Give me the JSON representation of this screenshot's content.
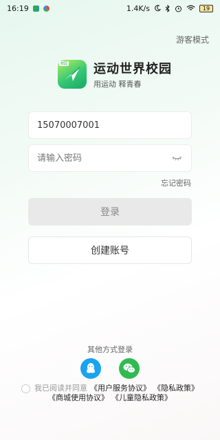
{
  "status_bar": {
    "time": "16:19",
    "network_speed": "1.4K/s",
    "battery": "19"
  },
  "header": {
    "guest_mode": "游客模式"
  },
  "brand": {
    "badge": "校园",
    "name": "运动世界校园",
    "slogan": "用运动 释青春",
    "accent_color": "#2ca66c"
  },
  "form": {
    "phone_value": "15070007001",
    "password_placeholder": "请输入密码",
    "forgot_password": "忘记密码"
  },
  "buttons": {
    "login": "登录",
    "create_account": "创建账号"
  },
  "other_login": {
    "label": "其他方式登录",
    "methods": [
      "qq-icon",
      "wechat-icon"
    ]
  },
  "agreement": {
    "prefix": "我已阅读并同意",
    "user_service": "《用户服务协议》",
    "privacy": "《隐私政策》",
    "mall_usage": "《商城使用协议》",
    "child_privacy": "《儿童隐私政策》"
  }
}
